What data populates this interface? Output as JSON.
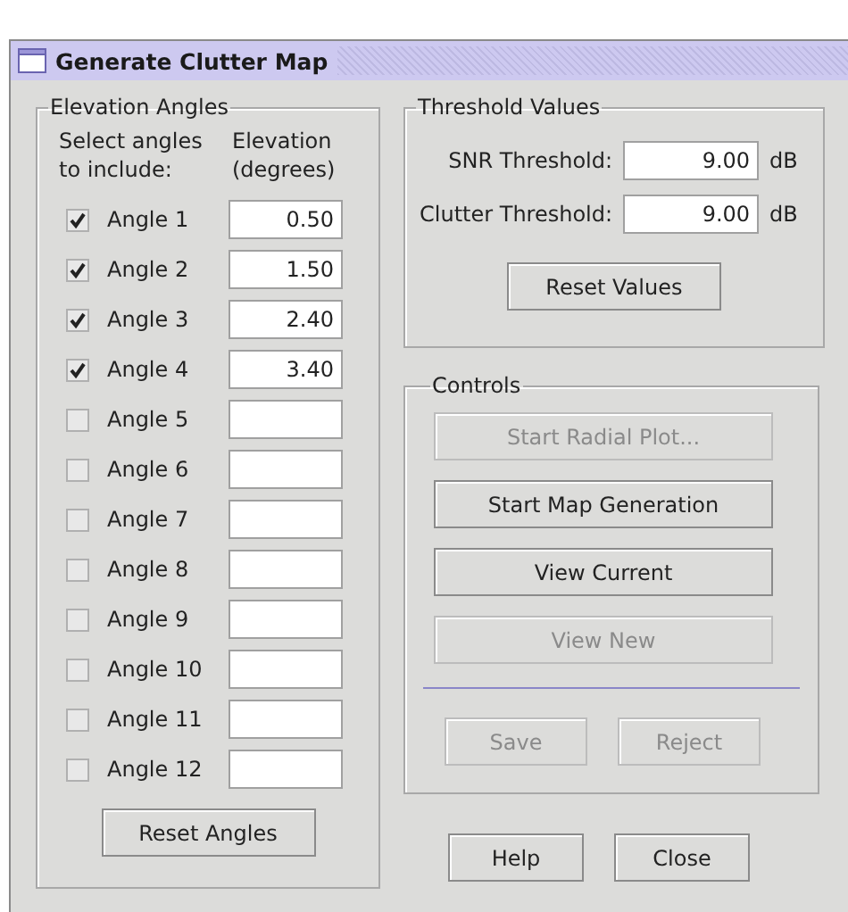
{
  "window": {
    "title": "Generate Clutter Map"
  },
  "elevation_angles": {
    "title": "Elevation Angles",
    "select_header": "Select angles to include:",
    "elevation_header": "Elevation (degrees)",
    "angles": [
      {
        "label": "Angle 1",
        "checked": true,
        "value": "0.50"
      },
      {
        "label": "Angle 2",
        "checked": true,
        "value": "1.50"
      },
      {
        "label": "Angle 3",
        "checked": true,
        "value": "2.40"
      },
      {
        "label": "Angle 4",
        "checked": true,
        "value": "3.40"
      },
      {
        "label": "Angle 5",
        "checked": false
      },
      {
        "label": "Angle 6",
        "checked": false
      },
      {
        "label": "Angle 7",
        "checked": false
      },
      {
        "label": "Angle 8",
        "checked": false
      },
      {
        "label": "Angle 9",
        "checked": false
      },
      {
        "label": "Angle 10",
        "checked": false
      },
      {
        "label": "Angle 11",
        "checked": false
      },
      {
        "label": "Angle 12",
        "checked": false
      }
    ],
    "reset_button": {
      "label": "Reset Angles",
      "disabled": false
    }
  },
  "threshold_values": {
    "title": "Threshold Values",
    "fields": [
      {
        "label": "SNR Threshold:",
        "value": "9.00",
        "unit": "dB"
      },
      {
        "label": "Clutter Threshold:",
        "value": "9.00",
        "unit": "dB"
      }
    ],
    "reset_button": {
      "label": "Reset Values",
      "disabled": false
    }
  },
  "controls": {
    "title": "Controls",
    "buttons": [
      {
        "label": "Start Radial Plot...",
        "disabled": true
      },
      {
        "label": "Start Map Generation",
        "disabled": false
      },
      {
        "label": "View Current",
        "disabled": false
      },
      {
        "label": "View New",
        "disabled": true
      }
    ],
    "bottom_buttons": [
      {
        "label": "Save",
        "disabled": true
      },
      {
        "label": "Reject",
        "disabled": true
      }
    ]
  },
  "dialog_buttons": [
    {
      "label": "Help",
      "disabled": false
    },
    {
      "label": "Close",
      "disabled": false
    }
  ]
}
